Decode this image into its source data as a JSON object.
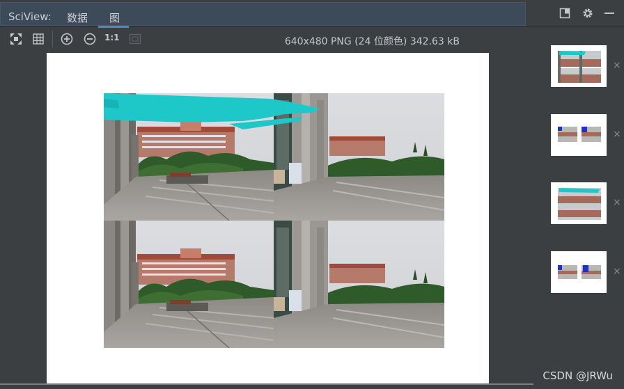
{
  "header": {
    "app_title": "SciView:",
    "tabs": [
      {
        "label": "数据"
      },
      {
        "label": "图",
        "active": true
      }
    ],
    "icons": [
      "window-icon",
      "gear-icon",
      "minimize-icon"
    ]
  },
  "toolbar": {
    "icons": [
      "fit-to-screen-icon",
      "grid-icon",
      "zoom-in-icon",
      "zoom-out-icon",
      "actual-size-icon",
      "fit-window-icon"
    ],
    "actual_size_label": "1:1",
    "image_info": "640x480 PNG (24 位颜色) 342.63 kB"
  },
  "thumbnails": [
    {
      "close_label": "×"
    },
    {
      "close_label": "×"
    },
    {
      "close_label": "×"
    },
    {
      "close_label": "×"
    }
  ],
  "watermark": "CSDN @JRWu",
  "colors": {
    "background": "#3c3f41",
    "header_bg": "#3d4a5a",
    "accent": "#4a88c7",
    "scribble_cyan": "#1ec8c8",
    "marker_blue": "#1f2fd6"
  }
}
